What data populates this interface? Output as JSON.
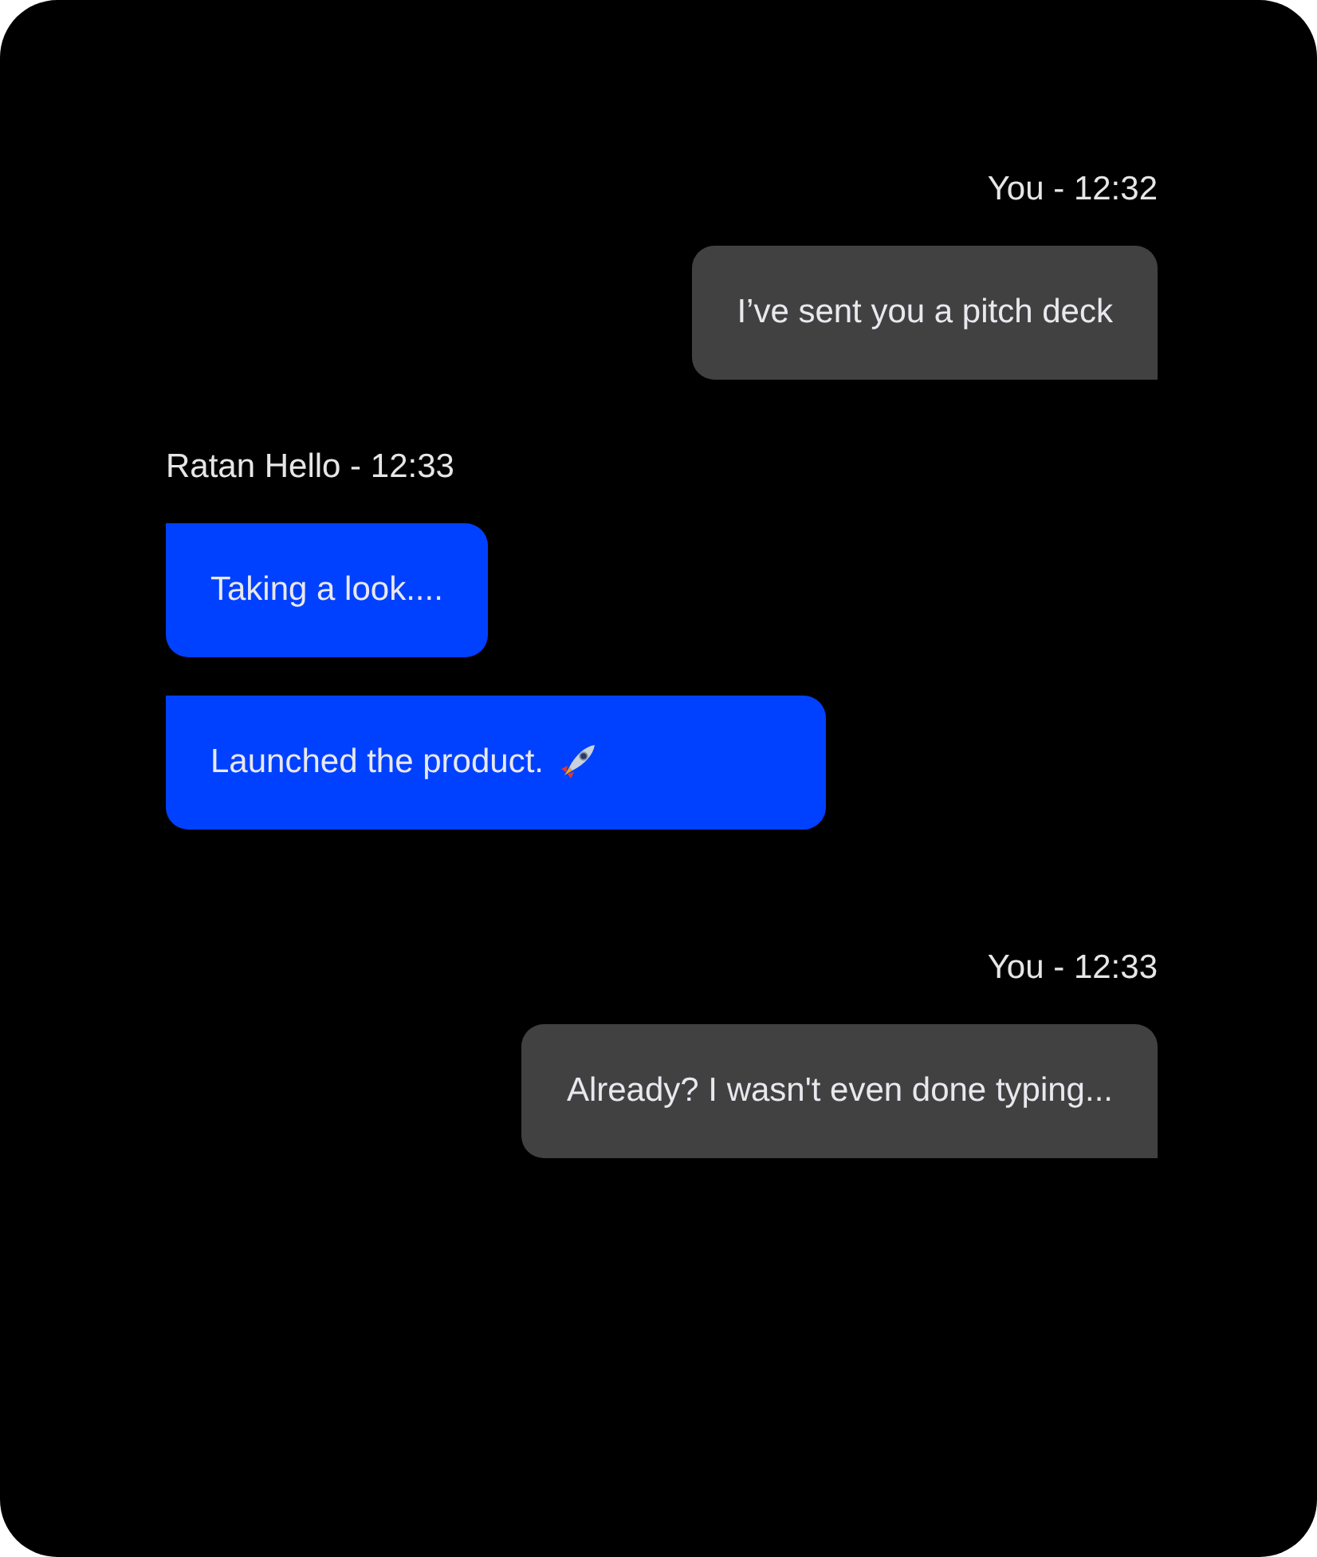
{
  "messages": [
    {
      "author": "You - 12:32",
      "outgoing": true,
      "bubbles": [
        {
          "text": "I’ve sent you a pitch deck",
          "trailing_icon": false
        }
      ]
    },
    {
      "author": "Ratan Hello - 12:33",
      "outgoing": false,
      "bubbles": [
        {
          "text": "Taking a look....",
          "trailing_icon": false
        },
        {
          "text": "Launched the product.",
          "trailing_icon": true
        }
      ]
    },
    {
      "author": "You - 12:33",
      "outgoing": true,
      "bubbles": [
        {
          "text": "Already? I wasn't even done typing...",
          "trailing_icon": false
        }
      ]
    }
  ]
}
